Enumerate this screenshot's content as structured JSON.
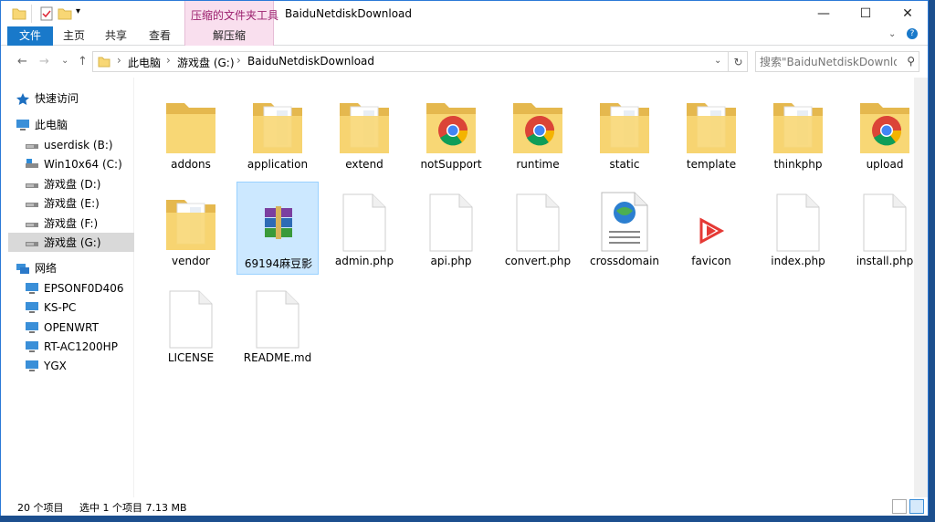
{
  "window": {
    "title": "BaiduNetdiskDownload",
    "context_tab_group": "压缩的文件夹工具",
    "controls": {
      "minimize": "—",
      "maximize": "☐",
      "close": "✕"
    }
  },
  "ribbon": {
    "tabs": [
      {
        "label": "文件"
      },
      {
        "label": "主页"
      },
      {
        "label": "共享"
      },
      {
        "label": "查看"
      },
      {
        "label": "解压缩"
      }
    ]
  },
  "address": {
    "crumbs": [
      "此电脑",
      "游戏盘 (G:)",
      "BaiduNetdiskDownload"
    ],
    "search_placeholder": "搜索\"BaiduNetdiskDownlo...",
    "nav": {
      "back": "←",
      "forward": "→",
      "recent": "⌄",
      "up": "↑"
    }
  },
  "nav_pane": {
    "items": [
      {
        "label": "快速访问",
        "icon": "star-icon"
      },
      {
        "label": "此电脑",
        "icon": "computer-icon"
      },
      {
        "label": "userdisk (B:)",
        "icon": "drive-icon"
      },
      {
        "label": "Win10x64 (C:)",
        "icon": "windows-drive-icon"
      },
      {
        "label": "游戏盘 (D:)",
        "icon": "drive-icon"
      },
      {
        "label": "游戏盘 (E:)",
        "icon": "drive-icon"
      },
      {
        "label": "游戏盘 (F:)",
        "icon": "drive-icon"
      },
      {
        "label": "游戏盘 (G:)",
        "icon": "drive-icon",
        "selected": true
      },
      {
        "label": "网络",
        "icon": "network-icon"
      },
      {
        "label": "EPSONF0D406",
        "icon": "monitor-icon"
      },
      {
        "label": "KS-PC",
        "icon": "monitor-icon"
      },
      {
        "label": "OPENWRT",
        "icon": "monitor-icon"
      },
      {
        "label": "RT-AC1200HP",
        "icon": "monitor-icon"
      },
      {
        "label": "YGX",
        "icon": "monitor-icon"
      }
    ]
  },
  "files": [
    {
      "name": "addons",
      "type": "folder"
    },
    {
      "name": "application",
      "type": "folder-doc"
    },
    {
      "name": "extend",
      "type": "folder-doc"
    },
    {
      "name": "notSupport",
      "type": "folder-chrome"
    },
    {
      "name": "runtime",
      "type": "folder-chrome"
    },
    {
      "name": "static",
      "type": "folder-doc"
    },
    {
      "name": "template",
      "type": "folder-doc"
    },
    {
      "name": "thinkphp",
      "type": "folder-doc"
    },
    {
      "name": "upload",
      "type": "folder-chrome"
    },
    {
      "name": "vendor",
      "type": "folder-doc"
    },
    {
      "name": "69194麻豆影",
      "type": "archive",
      "selected": true
    },
    {
      "name": "admin.php",
      "type": "file"
    },
    {
      "name": "api.php",
      "type": "file"
    },
    {
      "name": "convert.php",
      "type": "file"
    },
    {
      "name": "crossdomain",
      "type": "xml"
    },
    {
      "name": "favicon",
      "type": "favicon"
    },
    {
      "name": "index.php",
      "type": "file"
    },
    {
      "name": "install.php",
      "type": "file"
    },
    {
      "name": "LICENSE",
      "type": "file"
    },
    {
      "name": "README.md",
      "type": "file"
    }
  ],
  "status": {
    "item_count": "20 个项目",
    "selection": "选中 1 个项目  7.13 MB"
  },
  "colors": {
    "accent": "#1979ca",
    "context_tab": "#f9dfee",
    "selection": "#cce8ff",
    "folder": "#f8d775"
  }
}
